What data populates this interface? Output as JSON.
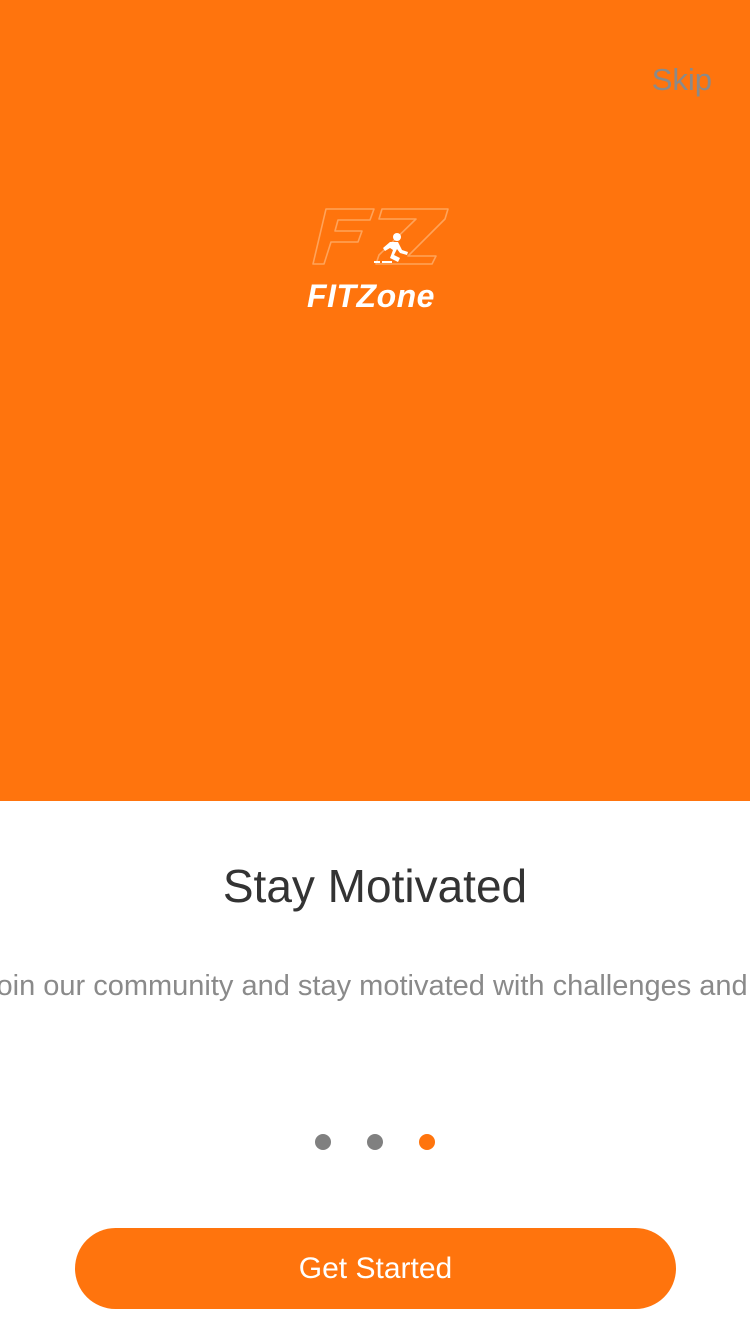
{
  "colors": {
    "accent": "#FF740D",
    "inactive_dot": "#808080",
    "title_text": "#333333",
    "muted_text": "#8a8a8a"
  },
  "header": {
    "skip_label": "Skip"
  },
  "brand": {
    "name": "FITZone",
    "icon": "runner-logo-icon"
  },
  "onboarding": {
    "title": "Stay Motivated",
    "description": "Join our community and stay motivated with challenges and rewards."
  },
  "pager": {
    "total": 3,
    "current": 3
  },
  "footer": {
    "cta_label": "Get Started"
  }
}
